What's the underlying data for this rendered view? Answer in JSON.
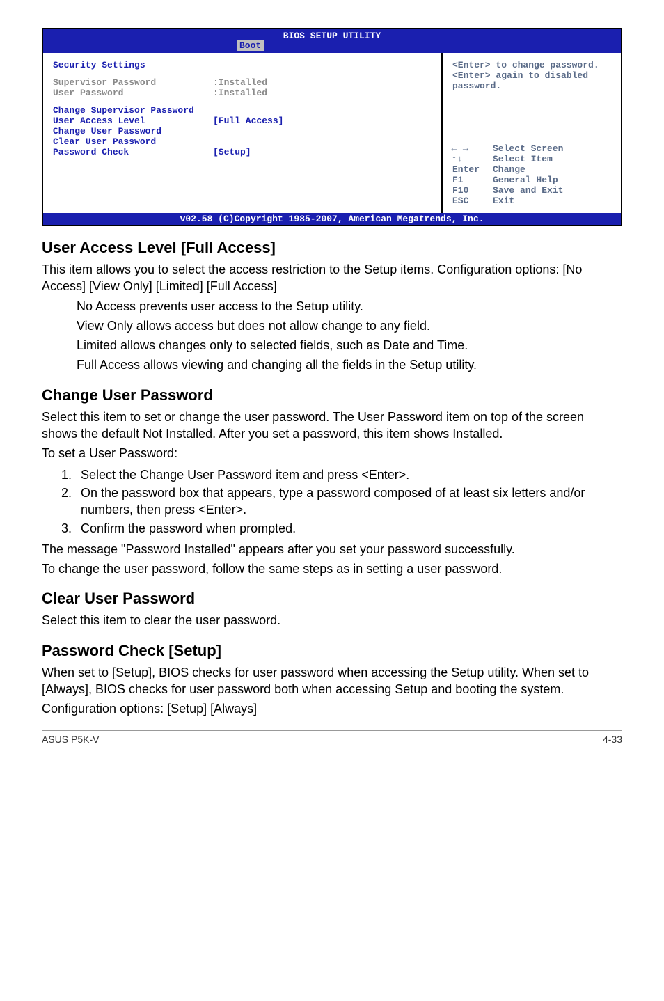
{
  "bios": {
    "title": "BIOS SETUP UTILITY",
    "tab": "Boot",
    "section_heading": "Security Settings",
    "status": {
      "supervisor_label": "Supervisor Password",
      "supervisor_value": ":Installed",
      "user_label": "User Password",
      "user_value": ":Installed"
    },
    "items": {
      "change_supervisor": "Change Supervisor Password",
      "user_access_label": "User Access Level",
      "user_access_value": "[Full Access]",
      "change_user": "Change User Password",
      "clear_user": "Clear User Password",
      "pw_check_label": "Password Check",
      "pw_check_value": "[Setup]"
    },
    "help": {
      "line1": "<Enter> to change password.",
      "line2": "<Enter> again to disabled password."
    },
    "keys": {
      "select_screen": "Select Screen",
      "select_item": "Select Item",
      "enter_key": "Enter",
      "enter_lbl": "Change",
      "f1_key": "F1",
      "f1_lbl": "General Help",
      "f10_key": "F10",
      "f10_lbl": "Save and Exit",
      "esc_key": "ESC",
      "esc_lbl": "Exit"
    },
    "footer": "v02.58 (C)Copyright 1985-2007, American Megatrends, Inc."
  },
  "sections": {
    "ual_heading": "User Access Level [Full Access]",
    "ual_p1": "This item allows you to select the access restriction to the Setup items. Configuration options: [No Access] [View Only] [Limited] [Full Access]",
    "ual_i1": "No Access prevents user access to the Setup utility.",
    "ual_i2": "View Only allows access but does not allow change to any field.",
    "ual_i3": "Limited allows changes only to selected fields, such as Date and Time.",
    "ual_i4": "Full Access allows viewing and changing all the fields in the Setup utility.",
    "cup_heading": "Change User Password",
    "cup_p1": "Select this item to set or change the user password. The User Password item on top of the screen shows the default Not Installed. After you set a password, this item shows Installed.",
    "cup_p2": "To set a User Password:",
    "cup_li1": "Select the Change User Password item and press <Enter>.",
    "cup_li2": "On the password box that appears, type a password composed of at least six letters and/or numbers, then press <Enter>.",
    "cup_li3": "Confirm the password when prompted.",
    "cup_p3": "The message \"Password Installed\" appears after you set your password successfully.",
    "cup_p4": "To change the user password, follow the same steps as in setting a user password.",
    "clrup_heading": "Clear User Password",
    "clrup_p1": "Select this item to clear the user password.",
    "pwc_heading": "Password Check [Setup]",
    "pwc_p1": "When set to [Setup], BIOS checks for user password when accessing the Setup utility. When set to [Always], BIOS checks for user password both when accessing Setup and booting the system.",
    "pwc_p2": "Configuration options: [Setup] [Always]"
  },
  "footer": {
    "left": "ASUS P5K-V",
    "right": "4-33"
  }
}
